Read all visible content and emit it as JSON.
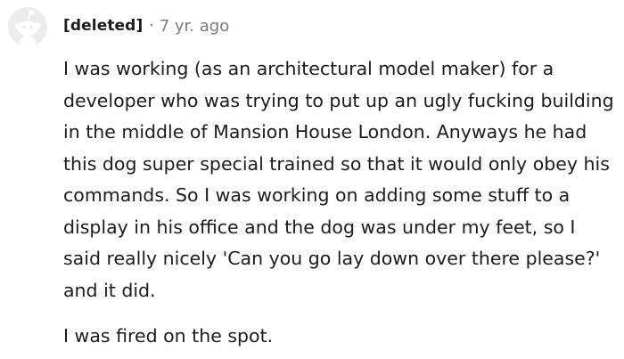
{
  "comment": {
    "author": "[deleted]",
    "separator": "·",
    "age": "7 yr. ago",
    "avatar_icon": "default-reddit-snoo-icon",
    "paragraphs": [
      "I was working (as an architectural model maker) for a developer who was trying to put up an ugly fucking building in the middle of Mansion House London. Anyways he had this dog super special trained so that it would only obey his commands. So I was working on adding some stuff to a display in his office and the dog was under my feet, so I said really nicely 'Can you go lay down over there please?' and it did.",
      "I was fired on the spot."
    ]
  },
  "colors": {
    "avatar_bg": "#ececec",
    "avatar_fg": "#ffffff",
    "text": "#1c1c1c",
    "muted": "#7c7c7c"
  }
}
